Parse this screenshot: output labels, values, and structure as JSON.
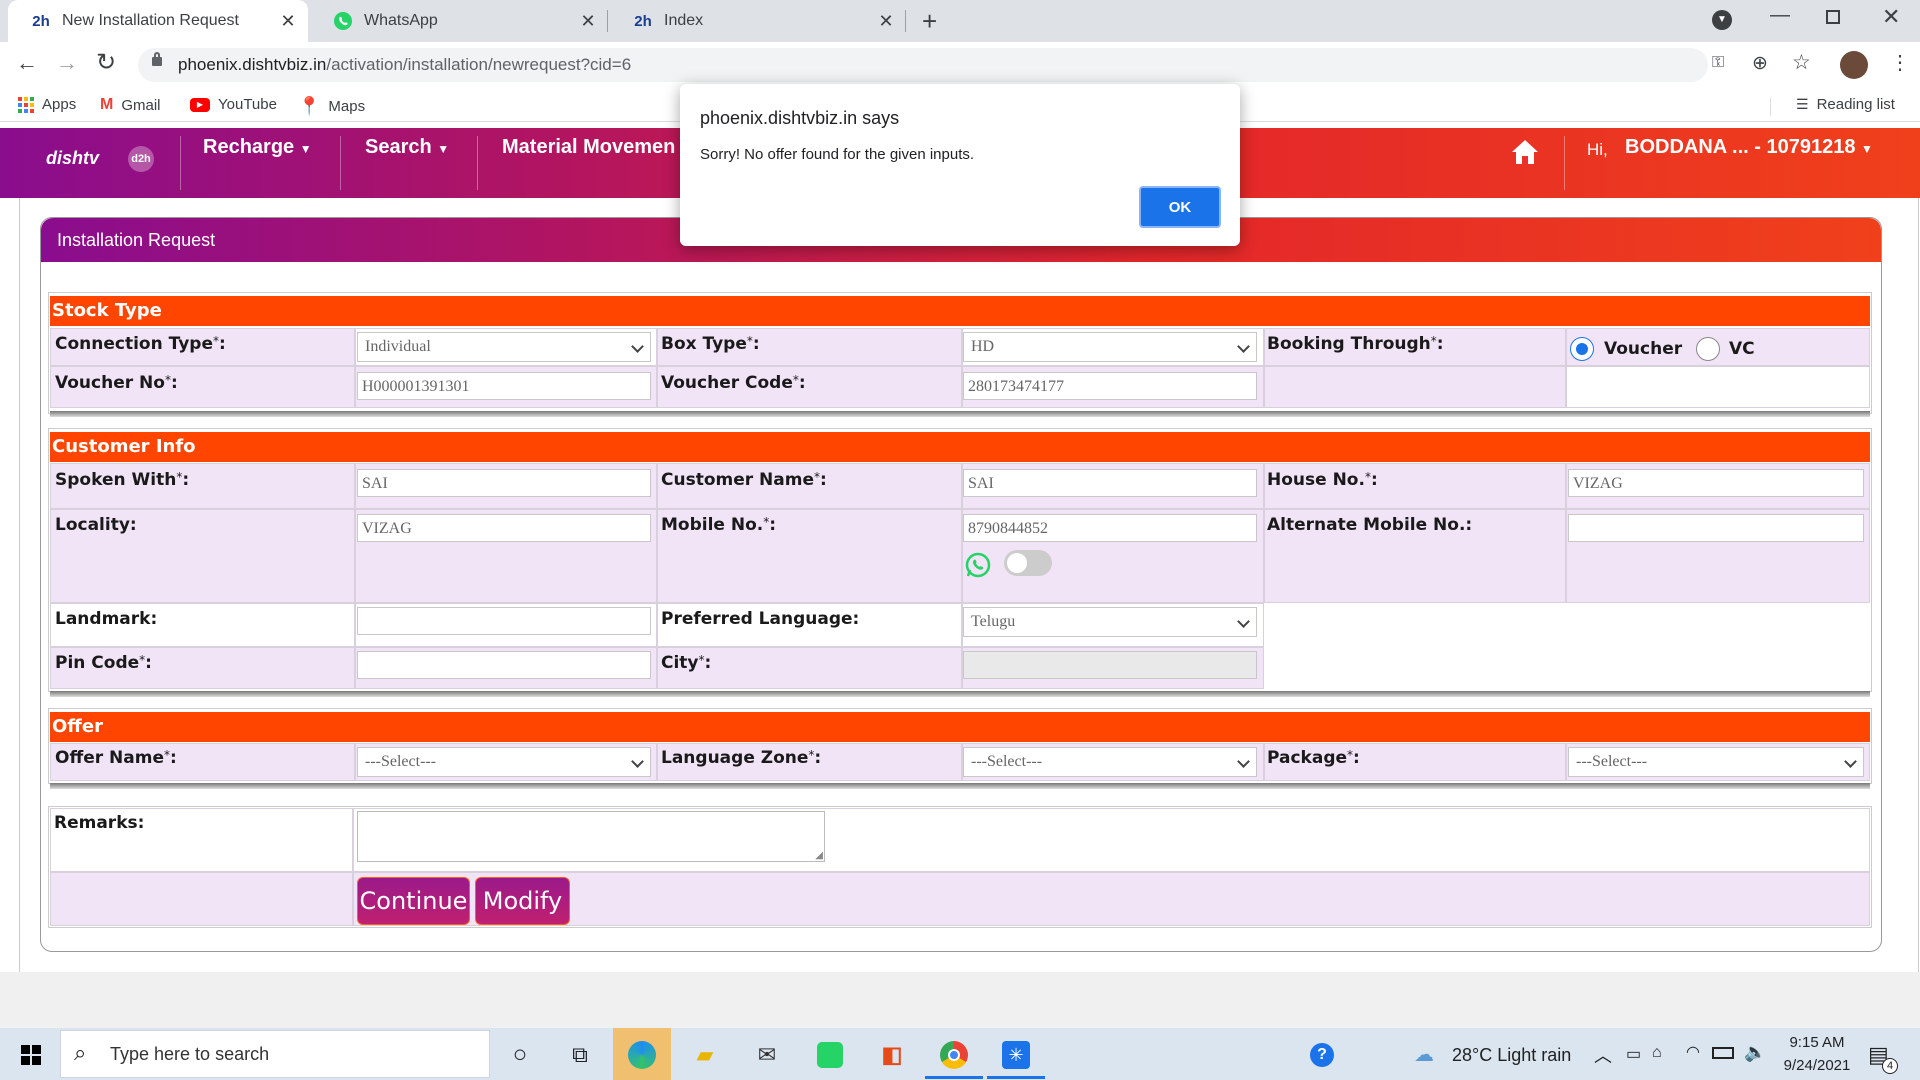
{
  "browser": {
    "tabs": [
      {
        "title": "New Installation Request"
      },
      {
        "title": "WhatsApp"
      },
      {
        "title": "Index"
      }
    ],
    "url_host": "phoenix.dishtvbiz.in",
    "url_path": "/activation/installation/newrequest?cid=6",
    "bookmarks": [
      "Apps",
      "Gmail",
      "YouTube",
      "Maps"
    ],
    "reading_list": "Reading list"
  },
  "site": {
    "logo": "dishtv",
    "logo2": "d2h",
    "nav": [
      "Recharge",
      "Search",
      "Material Movemen"
    ],
    "greeting": "Hi,",
    "user": "BODDANA ... - 10791218"
  },
  "dialog": {
    "title": "phoenix.dishtvbiz.in says",
    "message": "Sorry! No offer found for the given inputs.",
    "ok": "OK"
  },
  "panel_title": "Installation Request",
  "stock_type": {
    "header": "Stock Type",
    "connection_type_label": "Connection Type",
    "connection_type_value": "Individual",
    "box_type_label": "Box Type",
    "box_type_value": "HD",
    "booking_through_label": "Booking Through",
    "booking_options": [
      "Voucher",
      "VC"
    ],
    "booking_selected": "Voucher",
    "voucher_no_label": "Voucher No",
    "voucher_no_value": "H000001391301",
    "voucher_code_label": "Voucher Code",
    "voucher_code_value": "280173474177"
  },
  "customer_info": {
    "header": "Customer Info",
    "spoken_with_label": "Spoken With",
    "spoken_with_value": "SAI",
    "customer_name_label": "Customer Name",
    "customer_name_value": "SAI",
    "house_no_label": "House No.",
    "house_no_value": "VIZAG",
    "locality_label": "Locality:",
    "locality_value": "VIZAG",
    "mobile_label": "Mobile No.",
    "mobile_value": "8790844852",
    "alt_mobile_label": "Alternate Mobile No.:",
    "alt_mobile_value": "",
    "landmark_label": "Landmark:",
    "landmark_value": "",
    "preferred_language_label": "Preferred Language:",
    "preferred_language_value": "Telugu",
    "pin_code_label": "Pin Code",
    "pin_code_value": "",
    "city_label": "City",
    "city_value": ""
  },
  "offer": {
    "header": "Offer",
    "offer_name_label": "Offer Name",
    "offer_name_value": "---Select---",
    "language_zone_label": "Language Zone",
    "language_zone_value": "---Select---",
    "package_label": "Package",
    "package_value": "---Select---"
  },
  "remarks_label": "Remarks:",
  "buttons": {
    "continue": "Continue",
    "modify": "Modify"
  },
  "taskbar": {
    "search_placeholder": "Type here to search",
    "weather": "28°C  Light rain",
    "time": "9:15 AM",
    "date": "9/24/2021",
    "notifications": "4"
  },
  "colors": {
    "accent_orange": "#ff4500",
    "header_purple": "#8a0d8e",
    "row_lavender": "#f2e4f7",
    "ok_blue": "#1a73e8"
  }
}
